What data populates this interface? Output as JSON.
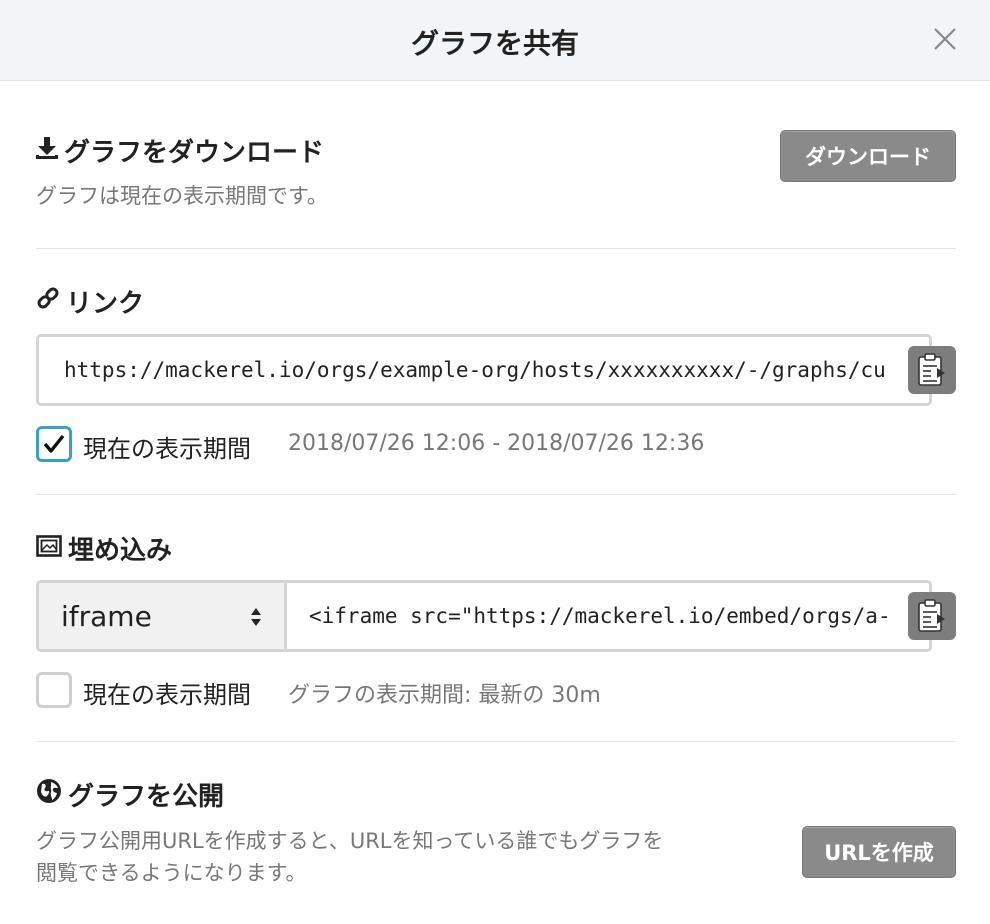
{
  "dialog": {
    "title": "グラフを共有",
    "close_icon": "close-icon"
  },
  "download": {
    "title": "グラフをダウンロード",
    "icon": "download-icon",
    "description": "グラフは現在の表示期間です。",
    "button_label": "ダウンロード"
  },
  "link": {
    "title": "リンク",
    "icon": "link-icon",
    "url": "https://mackerel.io/orgs/example-org/hosts/xxxxxxxxxx/-/graphs/cu",
    "copy_icon": "clipboard-icon",
    "checkbox_label": "現在の表示期間",
    "checkbox_checked": true,
    "period_text": "2018/07/26 12:06 - 2018/07/26 12:36"
  },
  "embed": {
    "title": "埋め込み",
    "icon": "image-frame-icon",
    "format_selected": "iframe",
    "code": "<iframe src=\"https://mackerel.io/embed/orgs/a-",
    "copy_icon": "clipboard-icon",
    "checkbox_label": "現在の表示期間",
    "checkbox_checked": false,
    "period_text": "グラフの表示期間: 最新の 30m"
  },
  "publish": {
    "title": "グラフを公開",
    "icon": "globe-icon",
    "description_line1": "グラフ公開用URLを作成すると、URLを知っている誰でもグラフを",
    "description_line2": "閲覧できるようになります。",
    "button_label": "URLを作成"
  },
  "colors": {
    "header_bg": "#f3f4f6",
    "button_bg": "#8a8a8a",
    "checkbox_accent": "#3aa0c8"
  }
}
